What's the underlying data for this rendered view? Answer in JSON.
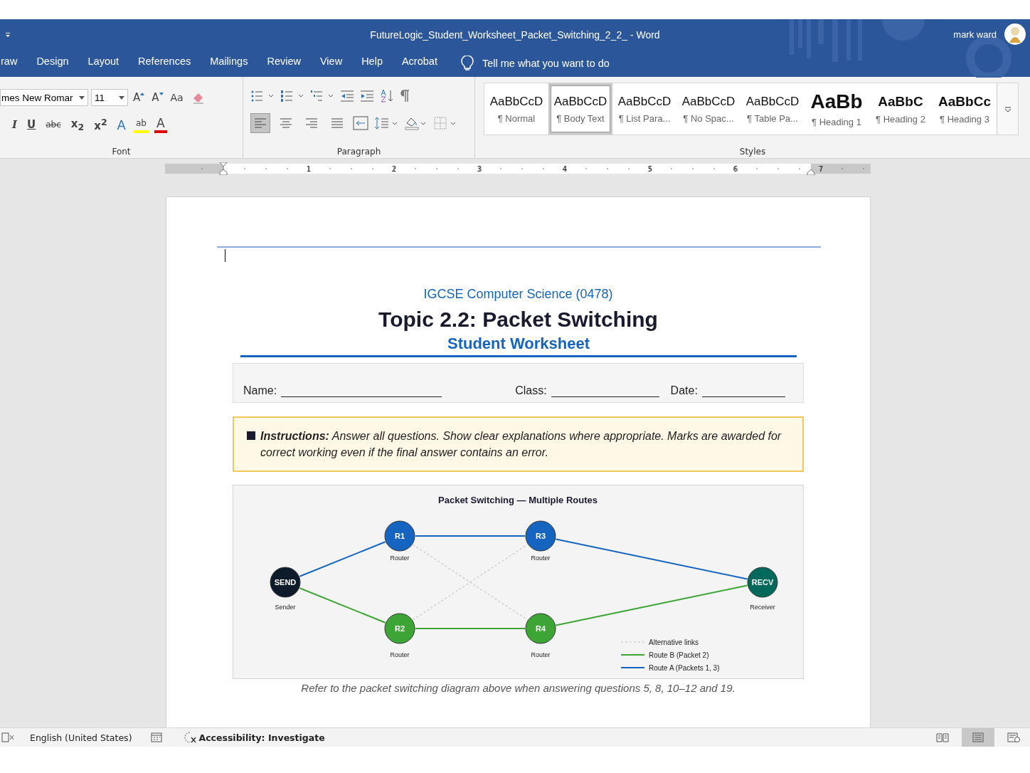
{
  "window": {
    "title": "FutureLogic_Student_Worksheet_Packet_Switching_2_2_  -  Word",
    "user": "mark ward"
  },
  "tabs": [
    {
      "label": "raw",
      "selected": false
    },
    {
      "label": "Design",
      "selected": false
    },
    {
      "label": "Layout",
      "selected": false
    },
    {
      "label": "References",
      "selected": false
    },
    {
      "label": "Mailings",
      "selected": false
    },
    {
      "label": "Review",
      "selected": false
    },
    {
      "label": "View",
      "selected": false
    },
    {
      "label": "Help",
      "selected": false
    },
    {
      "label": "Acrobat",
      "selected": false
    }
  ],
  "tell_me": {
    "placeholder": "Tell me what you want to do"
  },
  "font_group": {
    "label": "Font",
    "font_name": "mes New Romar",
    "font_size": "11",
    "row1": [
      {
        "kind": "grow",
        "label": "A"
      },
      {
        "kind": "shrink",
        "label": "A"
      },
      {
        "kind": "case",
        "label": "Aa"
      },
      {
        "kind": "clear"
      }
    ],
    "row2": [
      {
        "kind": "italic",
        "label": "I"
      },
      {
        "kind": "underline",
        "label": "U"
      },
      {
        "kind": "strike",
        "label": "abc"
      },
      {
        "kind": "sub",
        "label": "x$_{2}$"
      },
      {
        "kind": "sup",
        "label": "x$^{2}$"
      },
      {
        "kind": "effects",
        "label": "A"
      },
      {
        "kind": "highlight",
        "label": "ab"
      },
      {
        "kind": "color",
        "label": "A"
      }
    ]
  },
  "paragraph_group": {
    "label": "Paragraph",
    "align": [
      {
        "kind": "left",
        "selected": true
      },
      {
        "kind": "center",
        "selected": false
      },
      {
        "kind": "right",
        "selected": false
      },
      {
        "kind": "justify",
        "selected": false
      }
    ]
  },
  "styles_group": {
    "label": "Styles",
    "items": [
      {
        "preview": "AaBbCcD",
        "name": "¶ Normal",
        "kind": "plain",
        "selected": false
      },
      {
        "preview": "AaBbCcD",
        "name": "¶ Body Text",
        "kind": "plain",
        "selected": true
      },
      {
        "preview": "AaBbCcD",
        "name": "¶ List Para...",
        "kind": "plain",
        "selected": false
      },
      {
        "preview": "AaBbCcD",
        "name": "¶ No Spac...",
        "kind": "plain",
        "selected": false
      },
      {
        "preview": "AaBbCcD",
        "name": "¶ Table Pa...",
        "kind": "plain",
        "selected": false
      },
      {
        "preview": "AaBb",
        "name": "¶ Heading 1",
        "kind": "title",
        "selected": false
      },
      {
        "preview": "AaBbC",
        "name": "¶ Heading 2",
        "kind": "heading",
        "selected": false
      },
      {
        "preview": "AaBbCc",
        "name": "¶ Heading 3",
        "kind": "heading",
        "selected": false
      }
    ]
  },
  "ruler": {
    "labels": [
      "1",
      "2",
      "3",
      "4",
      "5",
      "6",
      "7"
    ]
  },
  "document": {
    "subtitle": "IGCSE Computer Science (0478)",
    "title": "Topic 2.2: Packet Switching",
    "heading": "Student Worksheet",
    "fields": [
      {
        "label": "Name:"
      },
      {
        "label": "Class:"
      },
      {
        "label": "Date:"
      }
    ],
    "instructions": "**Instructions:** Answer all questions. Show clear explanations where appropriate. Marks are awarded for correct working even if the final answer contains an error.",
    "diagram": {
      "title": "Packet  Switching — Multiple Routes",
      "nodes": [
        {
          "label": "SEND",
          "caption": "Sender",
          "color": "#0d1b2a"
        },
        {
          "label": "R1",
          "caption": "Router",
          "color": "#1565c0"
        },
        {
          "label": "R3",
          "caption": "Router",
          "color": "#1565c0"
        },
        {
          "label": "R2",
          "caption": "Router",
          "color": "#3da535"
        },
        {
          "label": "R4",
          "caption": "Router",
          "color": "#3da535"
        },
        {
          "label": "RECV",
          "caption": "Receiver",
          "color": "#00695c"
        }
      ],
      "legend": [
        {
          "label": "Alternative links",
          "kind": "alt"
        },
        {
          "label": "Route B (Packet 2)",
          "kind": "route_b"
        },
        {
          "label": "Route A (Packets 1, 3)",
          "kind": "route_a"
        }
      ]
    },
    "caption": "Refer to the packet switching diagram above when answering questions 5, 8, 10–12 and 19."
  },
  "status_bar": {
    "language": "English (United States)",
    "accessibility": "Accessibility: Investigate",
    "views": [
      {
        "kind": "read",
        "selected": false
      },
      {
        "kind": "print",
        "selected": true
      },
      {
        "kind": "web",
        "selected": false
      }
    ]
  }
}
